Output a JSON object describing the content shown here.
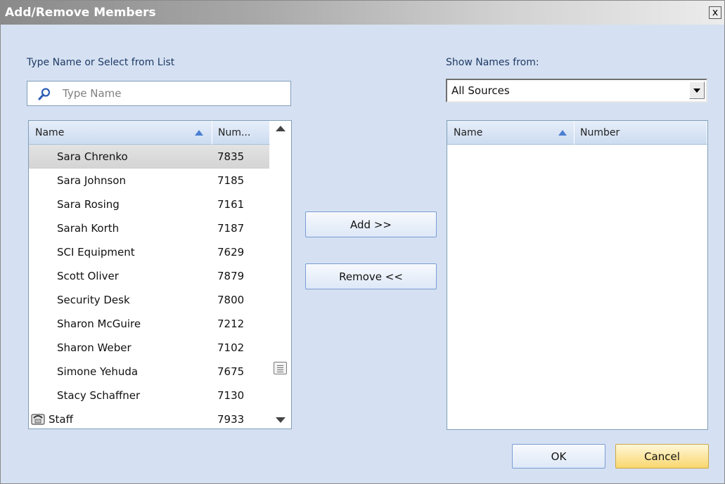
{
  "window": {
    "title": "Add/Remove Members",
    "close_glyph": "x"
  },
  "left": {
    "label": "Type Name or Select from List",
    "search": {
      "placeholder": "Type Name",
      "value": "",
      "icon": "search-icon"
    },
    "columns": {
      "name": "Name",
      "number": "Num..."
    },
    "rows": [
      {
        "name": "Sara Chrenko",
        "number": "7835",
        "selected": true
      },
      {
        "name": "Sara Johnson",
        "number": "7185"
      },
      {
        "name": "Sara Rosing",
        "number": "7161"
      },
      {
        "name": "Sarah Korth",
        "number": "7187"
      },
      {
        "name": "SCI Equipment",
        "number": "7629"
      },
      {
        "name": "Scott Oliver",
        "number": "7879"
      },
      {
        "name": "Security Desk",
        "number": "7800"
      },
      {
        "name": "Sharon McGuire",
        "number": "7212"
      },
      {
        "name": "Sharon Weber",
        "number": "7102"
      },
      {
        "name": "Simone Yehuda",
        "number": "7675"
      },
      {
        "name": "Stacy Schaffner",
        "number": "7130"
      },
      {
        "name": "Staff",
        "number": "7933",
        "icon": "phone-icon"
      }
    ]
  },
  "middle": {
    "add_label": "Add >>",
    "remove_label": "Remove <<"
  },
  "right": {
    "label": "Show Names from:",
    "source": {
      "selected": "All Sources"
    },
    "columns": {
      "name": "Name",
      "number": "Number"
    }
  },
  "footer": {
    "ok_label": "OK",
    "cancel_label": "Cancel"
  },
  "colors": {
    "dialog_bg": "#d5e1f2",
    "header_bg": "#cddcf1",
    "sort_arrow": "#4a7fd1",
    "cancel_accent": "#f9d76e"
  }
}
